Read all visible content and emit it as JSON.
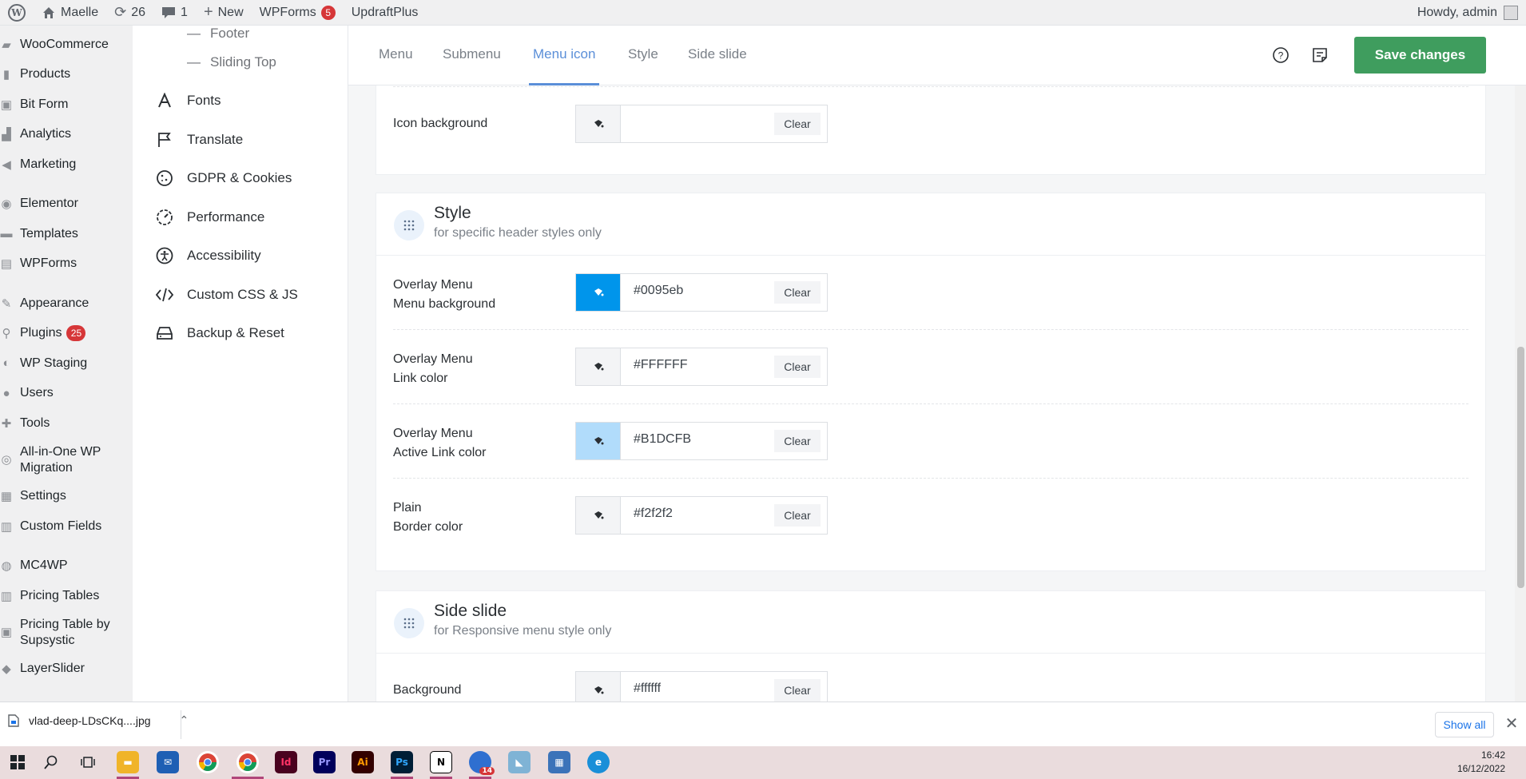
{
  "adminbar": {
    "site_name": "Maelle",
    "updates_count": "26",
    "comments_count": "1",
    "new_label": "New",
    "wpforms_label": "WPForms",
    "wpforms_badge": "5",
    "updraft_label": "UpdraftPlus",
    "howdy": "Howdy, admin"
  },
  "wpmenu": {
    "items": [
      {
        "label": "WooCommerce",
        "icon": "woocommerce-icon"
      },
      {
        "label": "Products",
        "icon": "products-icon"
      },
      {
        "label": "Bit Form",
        "icon": "bitform-icon"
      },
      {
        "label": "Analytics",
        "icon": "analytics-icon"
      },
      {
        "label": "Marketing",
        "icon": "megaphone-icon"
      },
      {
        "label": "Elementor",
        "icon": "elementor-icon"
      },
      {
        "label": "Templates",
        "icon": "folder-icon"
      },
      {
        "label": "WPForms",
        "icon": "wpforms-icon"
      },
      {
        "label": "Appearance",
        "icon": "brush-icon"
      },
      {
        "label": "Plugins",
        "icon": "plugin-icon",
        "badge": "25"
      },
      {
        "label": "WP Staging",
        "icon": "staging-icon"
      },
      {
        "label": "Users",
        "icon": "users-icon"
      },
      {
        "label": "Tools",
        "icon": "wrench-icon"
      },
      {
        "label": "All-in-One WP\nMigration",
        "icon": "migration-icon"
      },
      {
        "label": "Settings",
        "icon": "settings-icon"
      },
      {
        "label": "Custom Fields",
        "icon": "fields-icon"
      },
      {
        "label": "MC4WP",
        "icon": "mc4wp-icon"
      },
      {
        "label": "Pricing Tables",
        "icon": "pricing-icon"
      },
      {
        "label": "Pricing Table by\nSupsystic",
        "icon": "pricing2-icon"
      },
      {
        "label": "LayerSlider",
        "icon": "layers-icon"
      }
    ]
  },
  "plugnav": {
    "sub_items": [
      "Footer",
      "Sliding Top"
    ],
    "items": [
      {
        "label": "Fonts"
      },
      {
        "label": "Translate"
      },
      {
        "label": "GDPR & Cookies"
      },
      {
        "label": "Performance"
      },
      {
        "label": "Accessibility"
      },
      {
        "label": "Custom CSS & JS"
      },
      {
        "label": "Backup & Reset"
      }
    ]
  },
  "tabs": {
    "menu": "Menu",
    "submenu": "Submenu",
    "menu_icon": "Menu icon",
    "style": "Style",
    "side_slide": "Side slide",
    "save": "Save changes"
  },
  "icon_section": {
    "icon_bg_label": "Icon background",
    "icon_bg_value": "",
    "clear": "Clear"
  },
  "style_section": {
    "title": "Style",
    "subtitle": "for specific header styles only",
    "rows": [
      {
        "label1": "Overlay Menu",
        "label2": "Menu background",
        "value": "#0095eb",
        "swatch": "#0095eb"
      },
      {
        "label1": "Overlay Menu",
        "label2": "Link color",
        "value": "#FFFFFF",
        "swatch": "#f3f4f6"
      },
      {
        "label1": "Overlay Menu",
        "label2": "Active Link color",
        "value": "#B1DCFB",
        "swatch": "#b1dcfb"
      },
      {
        "label1": "Plain",
        "label2": "Border color",
        "value": "#f2f2f2",
        "swatch": "#f3f4f6"
      }
    ]
  },
  "side_slide_section": {
    "title": "Side slide",
    "subtitle": "for Responsive menu style only",
    "bg_label": "Background",
    "bg_value": "#ffffff"
  },
  "downloads": {
    "filename": "vlad-deep-LDsCKq....jpg",
    "show_all": "Show all"
  },
  "taskbar": {
    "time": "16:42",
    "date": "16/12/2022",
    "badge": "14"
  }
}
